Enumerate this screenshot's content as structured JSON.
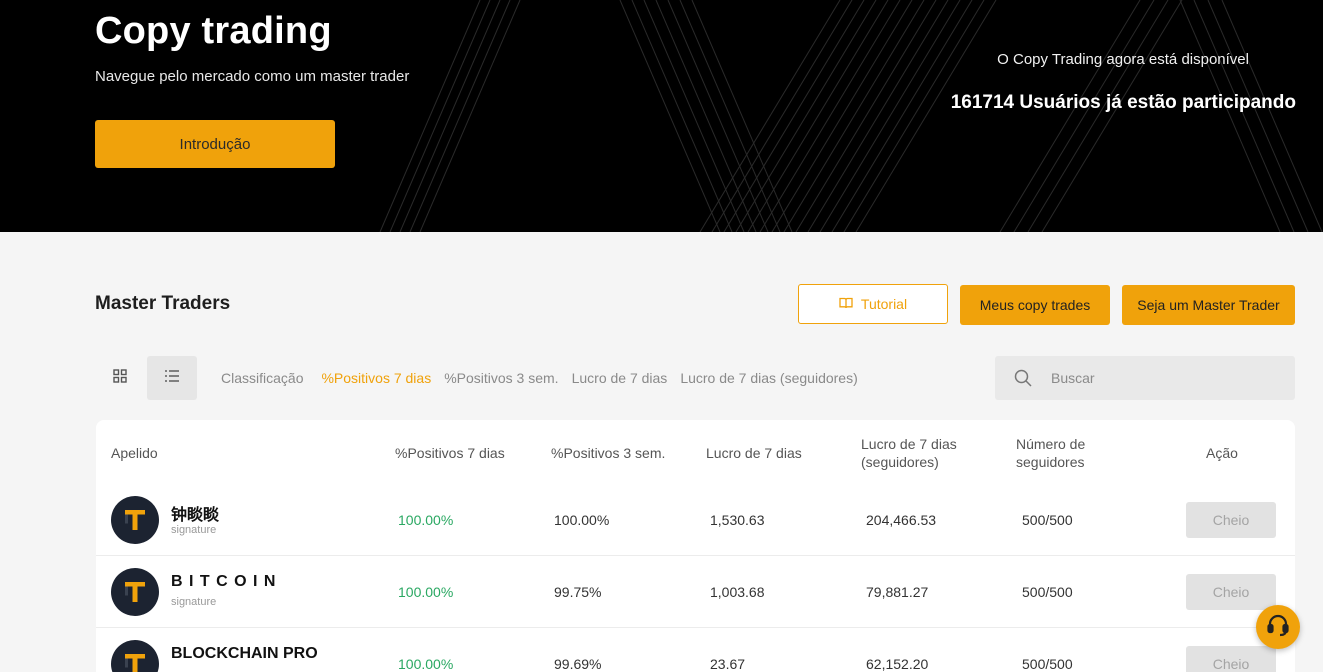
{
  "hero": {
    "title": "Copy trading",
    "subtitle": "Navegue pelo mercado como um master trader",
    "intro_button": "Introdução",
    "availability": "O Copy Trading agora está disponível",
    "users_line": "161714 Usuários já estão participando"
  },
  "section": {
    "title": "Master Traders",
    "tutorial_button": "Tutorial",
    "my_copy_button": "Meus copy trades",
    "become_master_button": "Seja um Master Trader"
  },
  "toolbar": {
    "sort_label": "Classificação",
    "sort_options": [
      "%Positivos 7 dias",
      "%Positivos 3 sem.",
      "Lucro de 7 dias",
      "Lucro de 7 dias (seguidores)"
    ],
    "active_sort": "%Positivos 7 dias",
    "search_placeholder": "Buscar"
  },
  "table": {
    "headers": [
      "Apelido",
      "%Positivos 7 dias",
      "%Positivos 3 sem.",
      "Lucro de 7 dias",
      "Lucro de 7 dias (seguidores)",
      "Número de seguidores",
      "Ação"
    ],
    "header_lines": {
      "followers_profit": [
        "Lucro de 7 dias",
        "(seguidores)"
      ],
      "followers_count": [
        "Número de",
        "seguidores"
      ]
    },
    "rows": [
      {
        "name": "钟睒睒",
        "signature": "signature",
        "win7": "100.00%",
        "win3w": "100.00%",
        "profit7": "1,530.63",
        "follower_profit": "204,466.53",
        "followers": "500/500",
        "action": "Cheio"
      },
      {
        "name": "B I T C O I N",
        "signature": "signature",
        "win7": "100.00%",
        "win3w": "99.75%",
        "profit7": "1,003.68",
        "follower_profit": "79,881.27",
        "followers": "500/500",
        "action": "Cheio"
      },
      {
        "name": "BLOCKCHAIN PRO",
        "signature": "",
        "win7": "100.00%",
        "win3w": "99.69%",
        "profit7": "23.67",
        "follower_profit": "62,152.20",
        "followers": "500/500",
        "action": "Cheio"
      }
    ]
  },
  "icons": {
    "tutorial": "book-icon",
    "grid_view": "grid-icon",
    "list_view": "list-icon",
    "search": "search-icon",
    "support": "headset-icon",
    "avatar": "t-logo-icon"
  },
  "colors": {
    "accent": "#f0a20b",
    "positive": "#2aa862",
    "hero_bg": "#000000",
    "avatar_bg": "#1c2331"
  }
}
